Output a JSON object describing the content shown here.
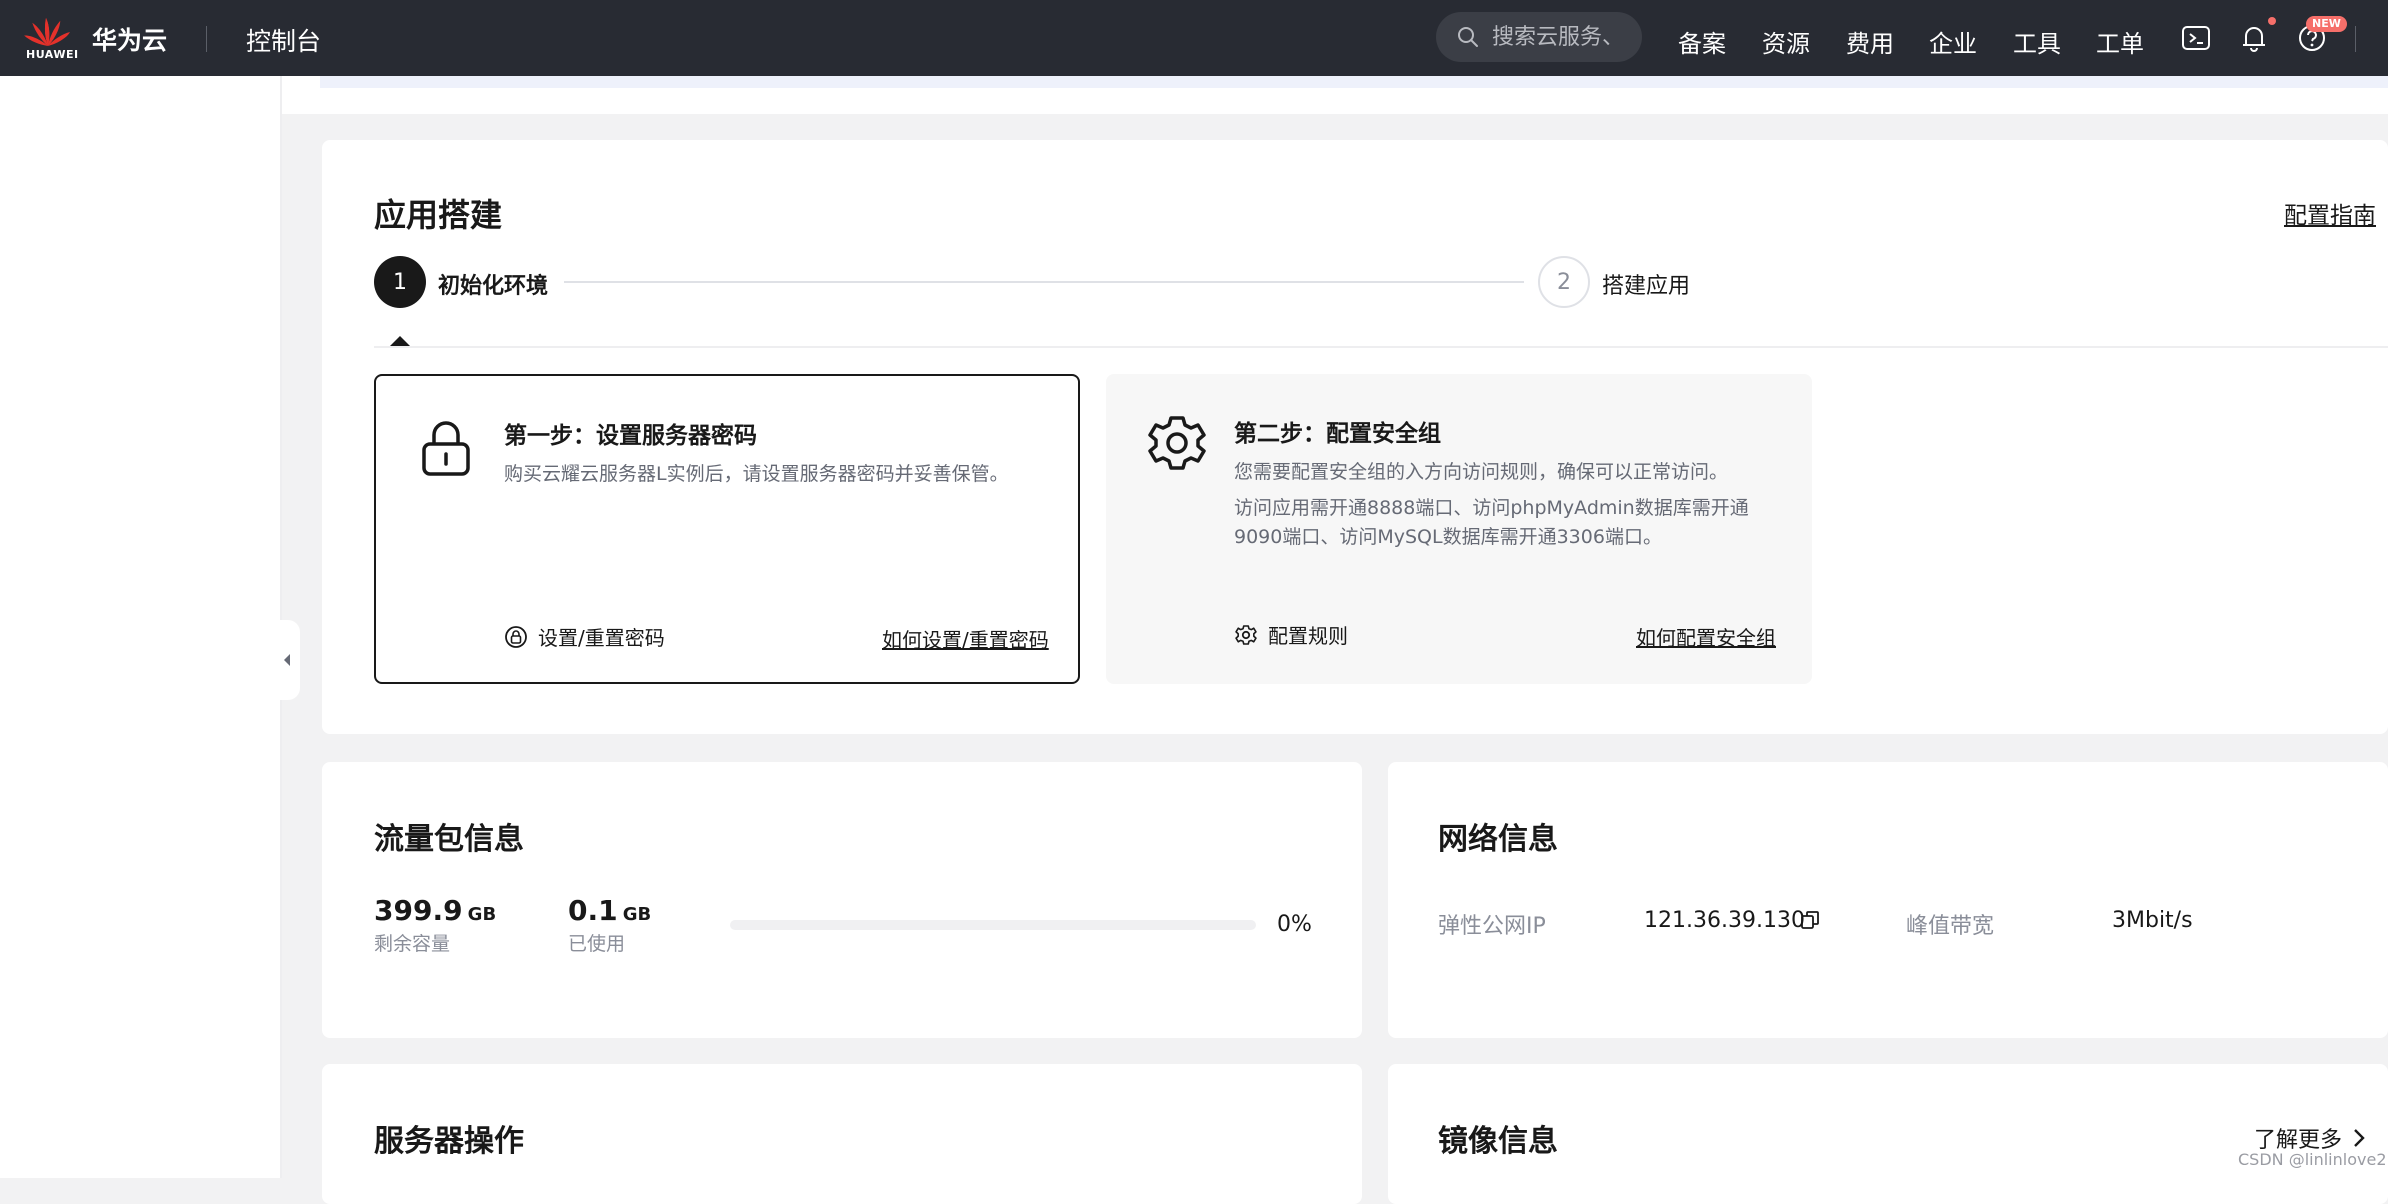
{
  "header": {
    "logo_text": "HUAWEI",
    "brand": "华为云",
    "console_title": "控制台",
    "search_placeholder": "搜索云服务、",
    "nav": [
      "备案",
      "资源",
      "费用",
      "企业",
      "工具",
      "工单"
    ],
    "new_badge": "NEW",
    "icons": [
      "terminal-icon",
      "bell-icon",
      "help-icon"
    ]
  },
  "app_build": {
    "title": "应用搭建",
    "guide_link": "配置指南",
    "steps": [
      {
        "number": "1",
        "label": "初始化环境",
        "active": true
      },
      {
        "number": "2",
        "label": "搭建应用",
        "active": false
      }
    ],
    "cards": [
      {
        "title": "第一步：设置服务器密码",
        "desc": [
          "购买云耀云服务器L实例后，请设置服务器密码并妥善保管。"
        ],
        "action": "设置/重置密码",
        "help_link": "如何设置/重置密码",
        "icon": "lock-icon"
      },
      {
        "title": "第二步：配置安全组",
        "desc": [
          "您需要配置安全组的入方向访问规则，确保可以正常访问。",
          "访问应用需开通8888端口、访问phpMyAdmin数据库需开通",
          "9090端口、访问MySQL数据库需开通3306端口。"
        ],
        "action": "配置规则",
        "help_link": "如何配置安全组",
        "icon": "gear-icon"
      }
    ]
  },
  "traffic": {
    "title": "流量包信息",
    "remaining_value": "399.9",
    "remaining_unit": "GB",
    "remaining_label": "剩余容量",
    "used_value": "0.1",
    "used_unit": "GB",
    "used_label": "已使用",
    "usage_percent_text": "0%",
    "usage_fraction": 0.0
  },
  "network": {
    "title": "网络信息",
    "ip_label": "弹性公网IP",
    "ip_value": "121.36.39.130",
    "bandwidth_label": "峰值带宽",
    "bandwidth_value": "3Mbit/s"
  },
  "server_ops": {
    "title": "服务器操作"
  },
  "image_info": {
    "title": "镜像信息",
    "more_link": "了解更多"
  },
  "watermark": "CSDN @linlinlove2",
  "colors": {
    "topbar": "#282b33",
    "accent_dark": "#191919",
    "notify_red": "#f66f6a"
  }
}
